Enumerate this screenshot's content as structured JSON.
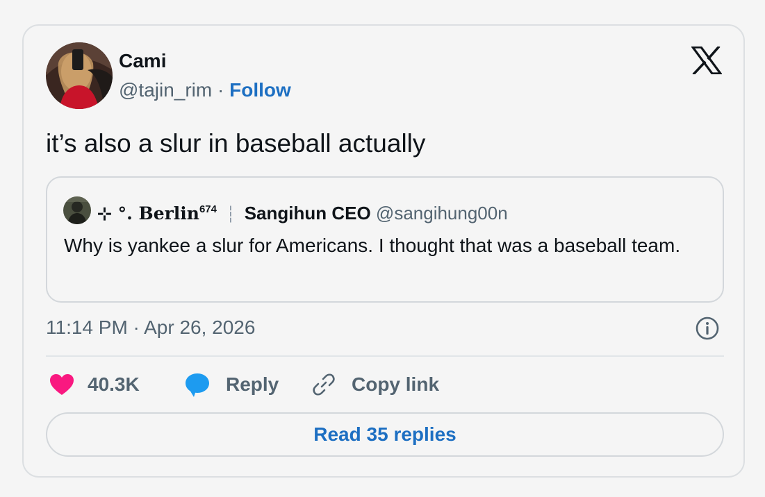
{
  "author": {
    "name": "Cami",
    "handle": "@tajin_rim",
    "separator": "·",
    "follow_label": "Follow"
  },
  "tweet": {
    "text": "it’s also a slur in baseball actually",
    "timestamp": "11:14 PM · Apr 26, 2026"
  },
  "quoted_tweet": {
    "display_name": "⊹ °. Berlin",
    "display_name_sup": "674",
    "name_separator": "┆",
    "second_name": "Sangihun CEO",
    "handle": "@sangihung00n",
    "text": "Why is yankee a slur for Americans. I thought that was a baseball team."
  },
  "actions": {
    "like_count": "40.3K",
    "reply_label": "Reply",
    "copy_link_label": "Copy link"
  },
  "read_replies_label": "Read 35 replies",
  "icons": {
    "platform": "x-logo-icon",
    "info": "info-icon",
    "like": "heart-icon",
    "reply": "speech-bubble-icon",
    "copy": "link-icon"
  },
  "colors": {
    "link_blue": "#1d6fc2",
    "like_pink": "#f91880",
    "reply_blue": "#1d9bf0",
    "secondary_text": "#536471",
    "border": "#d3d7db"
  }
}
